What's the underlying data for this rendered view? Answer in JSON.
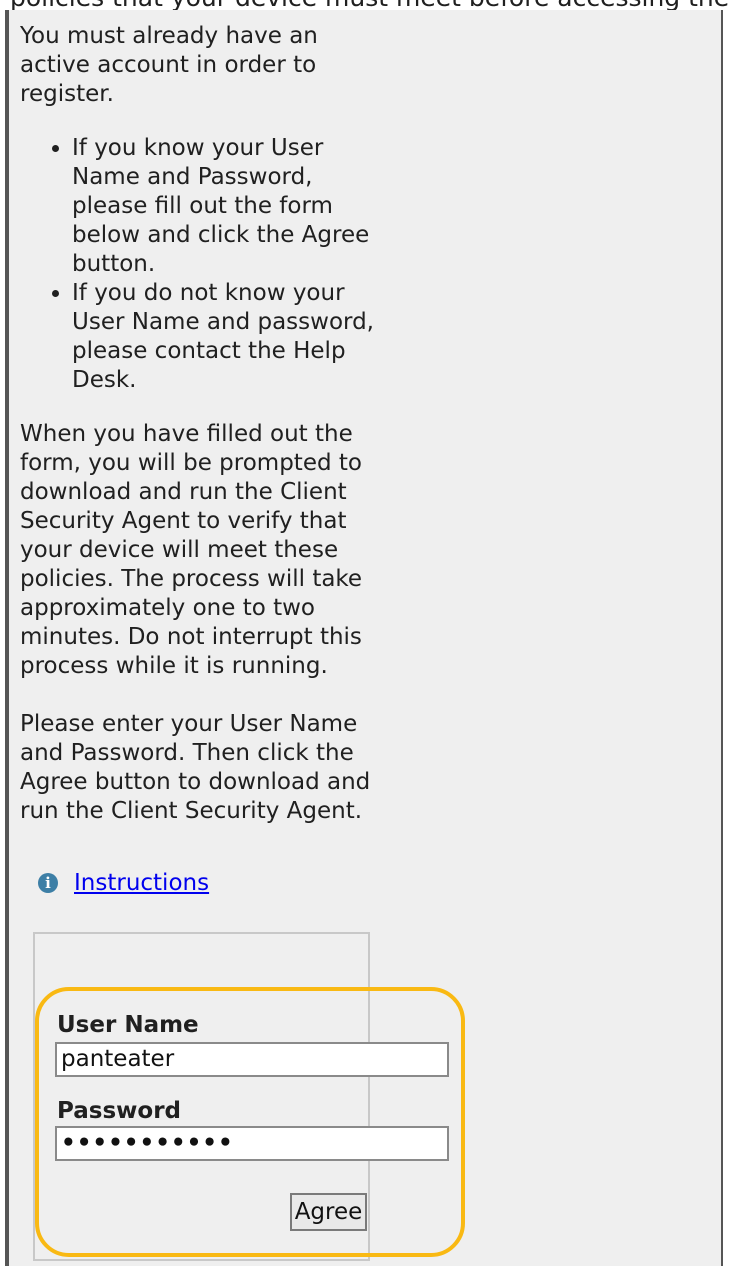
{
  "header": {
    "cutoff_text": "policies that your device must meet before accessing the"
  },
  "intro": "You must already have an active account in order to register.",
  "bullets": [
    "If you know your User Name and Password, please fill out the form below and click the Agree button.",
    "If you do not know your User Name and password, please contact the Help Desk."
  ],
  "paragraph_prompt": "When you have filled out the form, you will be prompted to download and run the Client Security Agent to verify that your device will meet these policies. The process will take approximately one to two minutes. Do not interrupt this process while it is running.",
  "paragraph_enter": "Please enter your User Name and Password. Then click the Agree button to download and run the Client Security Agent.",
  "instructions_link": "Instructions",
  "form": {
    "username_label": "User Name",
    "username_value": "panteater",
    "password_label": "Password",
    "password_mask": "•••••••••••",
    "agree_label": "Agree"
  },
  "colors": {
    "highlight": "#f9b913",
    "link": "#0000ee",
    "panel_bg": "#efefef"
  }
}
